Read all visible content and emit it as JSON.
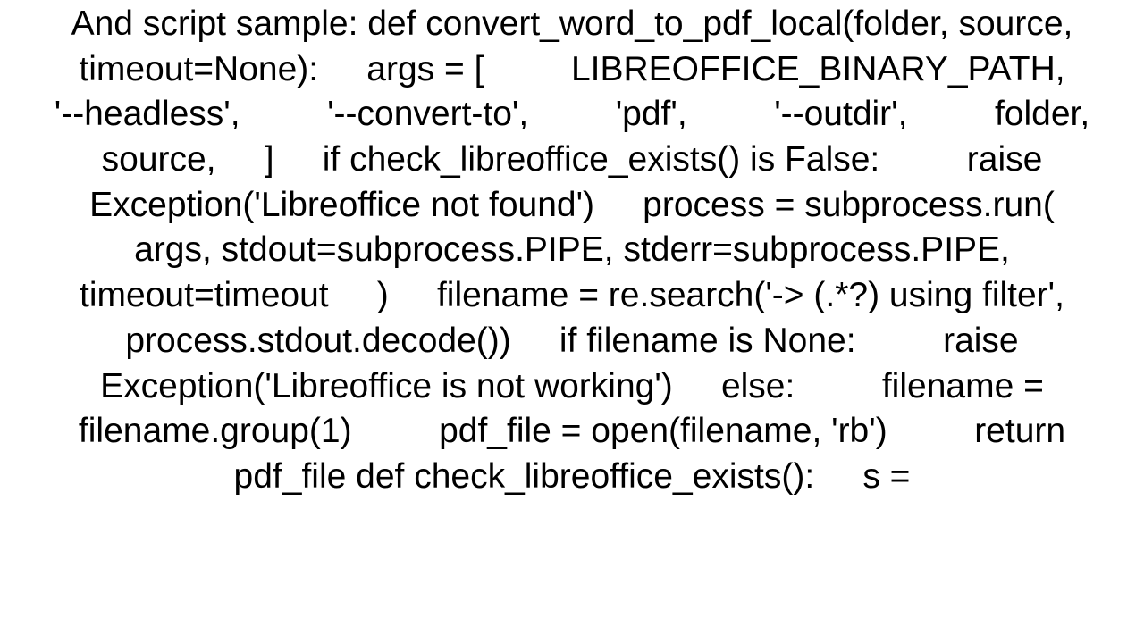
{
  "content": {
    "text": "And script sample: def convert_word_to_pdf_local(folder, source, timeout=None):     args = [         LIBREOFFICE_BINARY_PATH,         '--headless',         '--convert-to',         'pdf',         '--outdir',         folder,         source,     ]     if check_libreoffice_exists() is False:         raise Exception('Libreoffice not found')     process = subprocess.run(         args, stdout=subprocess.PIPE, stderr=subprocess.PIPE, timeout=timeout     )     filename = re.search('-> (.*?) using filter', process.stdout.decode())     if filename is None:         raise Exception('Libreoffice is not working')     else:         filename = filename.group(1)         pdf_file = open(filename, 'rb')         return pdf_file def check_libreoffice_exists():     s ="
  }
}
